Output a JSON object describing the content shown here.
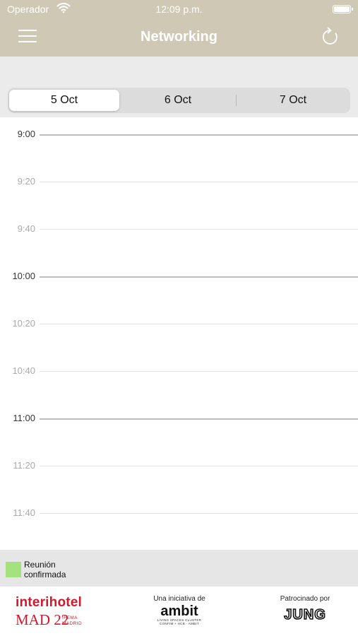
{
  "status_bar": {
    "carrier": "Operador",
    "time": "12:09 p.m."
  },
  "nav": {
    "title": "Networking",
    "menu_icon": "hamburger-menu-icon",
    "refresh_icon": "refresh-icon"
  },
  "date_tabs": [
    {
      "label": "5 Oct",
      "selected": true
    },
    {
      "label": "6 Oct",
      "selected": false
    },
    {
      "label": "7 Oct",
      "selected": false
    }
  ],
  "schedule": {
    "times": [
      {
        "label": "9:00",
        "hour": true
      },
      {
        "label": "9:20",
        "hour": false
      },
      {
        "label": "9:40",
        "hour": false
      },
      {
        "label": "10:00",
        "hour": true
      },
      {
        "label": "10:20",
        "hour": false
      },
      {
        "label": "10:40",
        "hour": false
      },
      {
        "label": "11:00",
        "hour": true
      },
      {
        "label": "11:20",
        "hour": false
      },
      {
        "label": "11:40",
        "hour": false
      }
    ]
  },
  "legend": {
    "label_line1": "Reunión",
    "label_line2": "confirmada",
    "swatch_color": "#a3e27e"
  },
  "footer": {
    "organizer": {
      "name": "interihotel",
      "edition": "MAD 22",
      "venue_line1": "IFEMA",
      "venue_line2": "MADRID"
    },
    "initiative": {
      "caption": "Una iniciativa de",
      "brand": "ambit",
      "tagline_line1": "LIVING SPACES CLUSTER",
      "tagline_line2": "CONFIM + HCB · AMBIT"
    },
    "sponsor": {
      "caption": "Patrocinado por",
      "brand": "JUNG"
    }
  },
  "colors": {
    "header": "#cfc8b4",
    "hour_text": "#333333",
    "minor_text": "#aaaaaa",
    "brand_red": "#d0192b"
  }
}
